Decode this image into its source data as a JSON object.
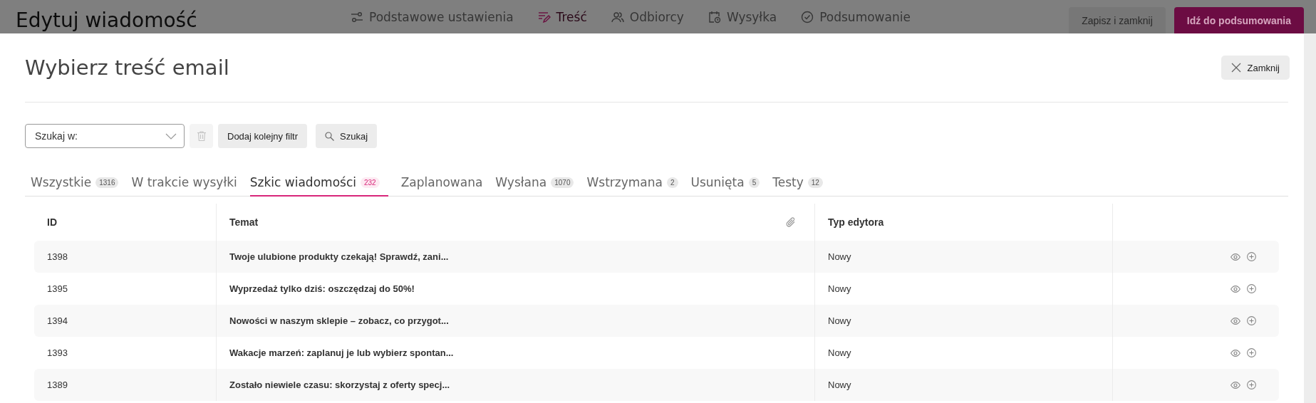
{
  "header": {
    "title": "Edytuj wiadomość",
    "steps": [
      {
        "label": "Podstawowe ustawienia",
        "kind": "sliders",
        "selected": false
      },
      {
        "label": "Treść",
        "kind": "content",
        "selected": true
      },
      {
        "label": "Odbiorcy",
        "kind": "people",
        "selected": false
      },
      {
        "label": "Wysyłka",
        "kind": "calendar",
        "selected": false
      },
      {
        "label": "Podsumowanie",
        "kind": "check",
        "selected": false
      }
    ],
    "buttons": [
      {
        "label": "Zapisz i zamknij",
        "kind": "secondary"
      },
      {
        "label": "Idź do podsumowania",
        "kind": "primary"
      }
    ]
  },
  "dialog": {
    "title": "Wybierz treść email",
    "close_button": "Zamknij",
    "filter": {
      "select_placeholder": "Szukaj w:",
      "add_filter_button": "Dodaj kolejny filtr",
      "search_button": "Szukaj"
    },
    "tabs": [
      {
        "label": "Wszystkie",
        "count": "1316",
        "selected": false
      },
      {
        "label": "W trakcie wysyłki",
        "selected": false
      },
      {
        "label": "Szkic wiadomości",
        "count": "232",
        "selected": true
      },
      {
        "label": "Zaplanowana",
        "selected": false
      },
      {
        "label": "Wysłana",
        "count": "1070",
        "selected": false
      },
      {
        "label": "Wstrzymana",
        "count": "2",
        "selected": false
      },
      {
        "label": "Usunięta",
        "count": "5",
        "selected": false
      },
      {
        "label": "Testy",
        "count": "12",
        "selected": false
      }
    ],
    "table": {
      "columns": [
        "ID",
        "Temat",
        "Typ edytora"
      ],
      "rows": [
        {
          "id": "1398",
          "subject": "Twoje ulubione produkty czekają! Sprawdź, zani...",
          "editor": "Nowy"
        },
        {
          "id": "1395",
          "subject": "Wyprzedaż tylko dziś: oszczędzaj do 50%!",
          "editor": "Nowy"
        },
        {
          "id": "1394",
          "subject": "Nowości w naszym sklepie – zobacz, co przygot...",
          "editor": "Nowy"
        },
        {
          "id": "1393",
          "subject": "Wakacje marzeń: zaplanuj je lub wybierz spontan...",
          "editor": "Nowy"
        },
        {
          "id": "1389",
          "subject": "Zostało niewiele czasu: skorzystaj z oferty specj...",
          "editor": "Nowy"
        }
      ]
    }
  }
}
